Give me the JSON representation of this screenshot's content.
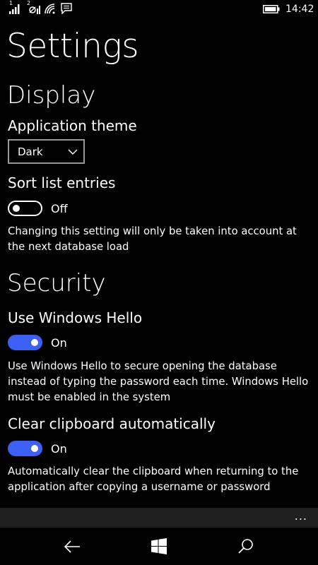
{
  "status_bar": {
    "sim1_label": "1",
    "sim2_label": "2",
    "time": "14:42",
    "icons": [
      "signal-icon",
      "sim2-signal-icon",
      "wifi-icon",
      "message-icon",
      "battery-icon"
    ]
  },
  "page": {
    "title": "Settings"
  },
  "display": {
    "title": "Display",
    "theme_label": "Application theme",
    "theme_value": "Dark",
    "sort_label": "Sort list entries",
    "sort_state": "Off",
    "sort_on": false,
    "sort_desc": "Changing this setting will only be taken into account at the next database load"
  },
  "security": {
    "title": "Security",
    "hello_label": "Use Windows Hello",
    "hello_state": "On",
    "hello_on": true,
    "hello_desc": "Use Windows Hello to secure opening the database instead of typing the password each time. Windows Hello must be enabled in the system",
    "clipboard_label": "Clear clipboard automatically",
    "clipboard_state": "On",
    "clipboard_on": true,
    "clipboard_desc": "Automatically clear the clipboard when returning to the application after copying a username or password"
  },
  "app_bar": {
    "more_label": "..."
  },
  "nav_bar": {
    "buttons": [
      "back-icon",
      "windows-home-icon",
      "search-icon"
    ]
  },
  "colors": {
    "accent": "#3C5FF4",
    "background": "#000000",
    "app_bar": "#1F1F1F"
  }
}
